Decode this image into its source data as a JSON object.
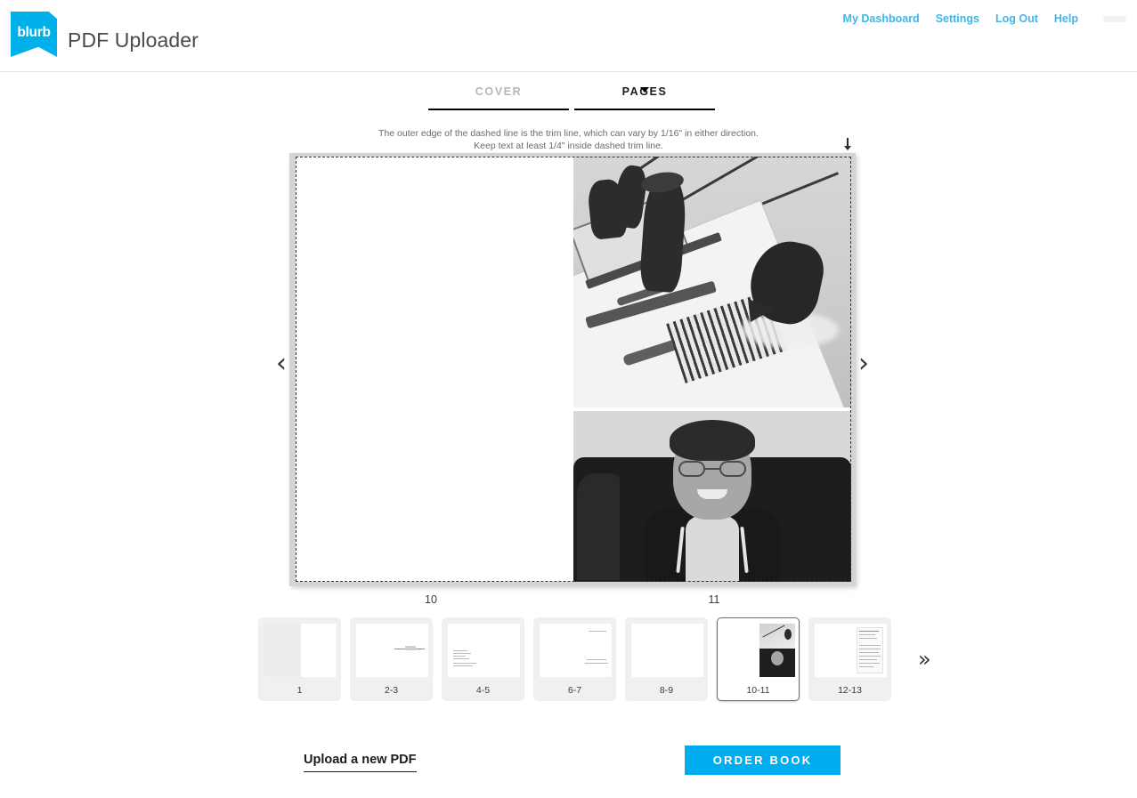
{
  "header": {
    "logo_text": "blurb",
    "app_title": "PDF Uploader",
    "nav": [
      {
        "label": "My Dashboard"
      },
      {
        "label": "Settings"
      },
      {
        "label": "Log Out"
      },
      {
        "label": "Help"
      }
    ]
  },
  "tabs": [
    {
      "label": "COVER",
      "active": false
    },
    {
      "label": "PAGES",
      "active": true
    }
  ],
  "helptext": {
    "line1": "The outer edge of the dashed line is the trim line, which can vary by 1/16\" in either direction.",
    "line2": "Keep text at least 1/4\" inside dashed trim line."
  },
  "preview": {
    "left_page_number": "10",
    "right_page_number": "11",
    "prev_arrow": "‹",
    "next_arrow": "›"
  },
  "thumbnails": [
    {
      "label": "1",
      "selected": false
    },
    {
      "label": "2-3",
      "selected": false
    },
    {
      "label": "4-5",
      "selected": false
    },
    {
      "label": "6-7",
      "selected": false
    },
    {
      "label": "8-9",
      "selected": false
    },
    {
      "label": "10-11",
      "selected": true
    },
    {
      "label": "12-13",
      "selected": false
    }
  ],
  "thumb_more": "»",
  "footer": {
    "upload_label": "Upload a new PDF",
    "order_label": "ORDER BOOK"
  },
  "colors": {
    "brand_cyan": "#00aeef",
    "nav_link": "#41b6e6",
    "active_tab": "#1c1c1c",
    "inactive_tab": "#b7b7b7"
  }
}
